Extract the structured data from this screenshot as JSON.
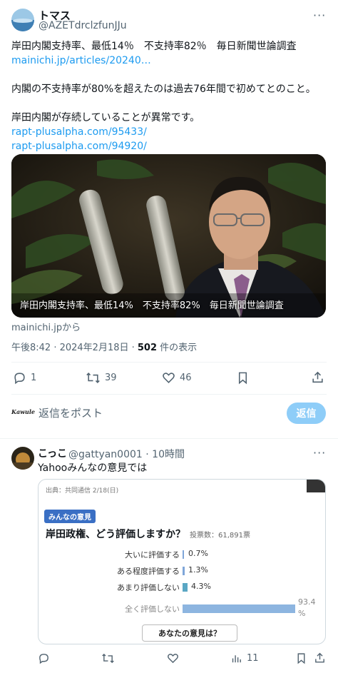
{
  "post": {
    "display_name": "トマス",
    "handle": "@AZETdrclzfunJJu",
    "more_icon": "more-horizontal-icon",
    "lines": [
      "岸田内閣支持率、最低14％　不支持率82％　毎日新聞世論調査",
      "mainichi.jp/articles/20240…",
      "内閣の不支持率が80%を超えたのは過去76年間で初めてとのこと。",
      "岸田内閣が存続していることが異常です。",
      "rapt-plusalpha.com/95433/",
      "rapt-plusalpha.com/94920/"
    ],
    "media_caption": "岸田内閣支持率、最低14%　不支持率82%　毎日新聞世論調査",
    "media_source": "mainichi.jpから",
    "time": "午後8:42 · 2024年2月18日 · ",
    "views_count": "502",
    "views_label": " 件の表示",
    "actions": {
      "replies": "1",
      "reposts": "39",
      "likes": "46"
    },
    "reply_box": {
      "logo": "Kawule",
      "placeholder": "返信をポスト",
      "button": "返信"
    }
  },
  "reply": {
    "display_name": "こっこ",
    "handle": "@gattyan0001 · 10時間",
    "text": "Yahooみんなの意見では",
    "views": "11",
    "card": {
      "source": "出典：共同通信 2/18(日)",
      "badge": "みんなの意見",
      "question": "岸田政権、どう評価しますか？",
      "votes": "投票数：61,891票",
      "options": [
        {
          "label": "大いに評価する",
          "percent": "0.7%",
          "value": 0.7
        },
        {
          "label": "ある程度評価する",
          "percent": "1.3%",
          "value": 1.3
        },
        {
          "label": "あまり評価しない",
          "percent": "4.3%",
          "value": 4.3
        },
        {
          "label": "全く評価しない",
          "percent": "93.4",
          "percent_suffix": "%",
          "value": 93.4
        }
      ],
      "button": "あなたの意見は？"
    }
  },
  "colors": {
    "link": "#1d9bf0",
    "muted": "#536471",
    "reply_button": "#8ecdf8",
    "badge": "#3a6fc4"
  }
}
